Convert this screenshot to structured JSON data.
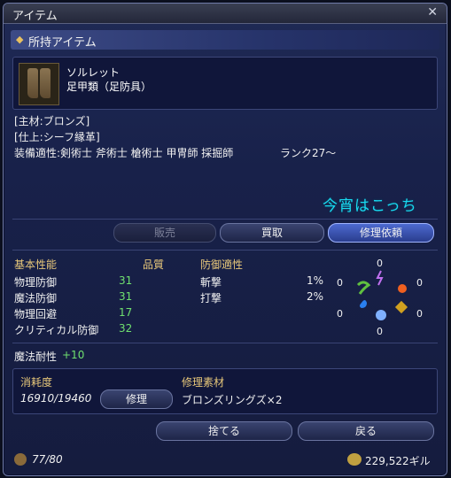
{
  "window": {
    "title": "アイテム",
    "close_symbol": "✕"
  },
  "section": {
    "title": "所持アイテム"
  },
  "item": {
    "name": "ソルレット",
    "category": "足甲類（足防具）",
    "material": "[主材:ブロンズ]",
    "finish": "[仕上:シーフ縁革]",
    "equip": "装備適性:剣術士  斧術士  槍術士  甲冑師  採掘師",
    "rank": "ランク27～"
  },
  "annotation": "今宵はこっち",
  "actions": {
    "sell": "販売",
    "take": "買取",
    "repair_request": "修理依頼"
  },
  "stats": {
    "basic_header": "基本性能",
    "quality_header": "品質",
    "defense_header": "防御適性",
    "rows": [
      {
        "label": "物理防御",
        "value": "31"
      },
      {
        "label": "魔法防御",
        "value": "31"
      },
      {
        "label": "物理回避",
        "value": "17"
      },
      {
        "label": "クリティカル防御",
        "value": "32"
      }
    ],
    "defense_rows": [
      {
        "label": "斬撃",
        "value": "1%"
      },
      {
        "label": "打撃",
        "value": "2%"
      }
    ],
    "magic_resist_label": "魔法耐性",
    "magic_resist_value": "+10"
  },
  "elements": {
    "top": "0",
    "left1": "0",
    "right1": "0",
    "left2": "0",
    "right2": "0",
    "bottom": "0"
  },
  "repair": {
    "durability_label": "消耗度",
    "durability_value": "16910/19460",
    "repair_button": "修理",
    "materials_label": "修理素材",
    "materials_value": "ブロンズリングズ×2"
  },
  "bottom_buttons": {
    "discard": "捨てる",
    "back": "戻る"
  },
  "footer": {
    "bag": "77/80",
    "gil": "229,522ギル"
  },
  "colors": {
    "accent": "#19d8f0",
    "stat_value": "#6fe06f",
    "header": "#e8c87a",
    "active_button": "#4d6ad0"
  }
}
